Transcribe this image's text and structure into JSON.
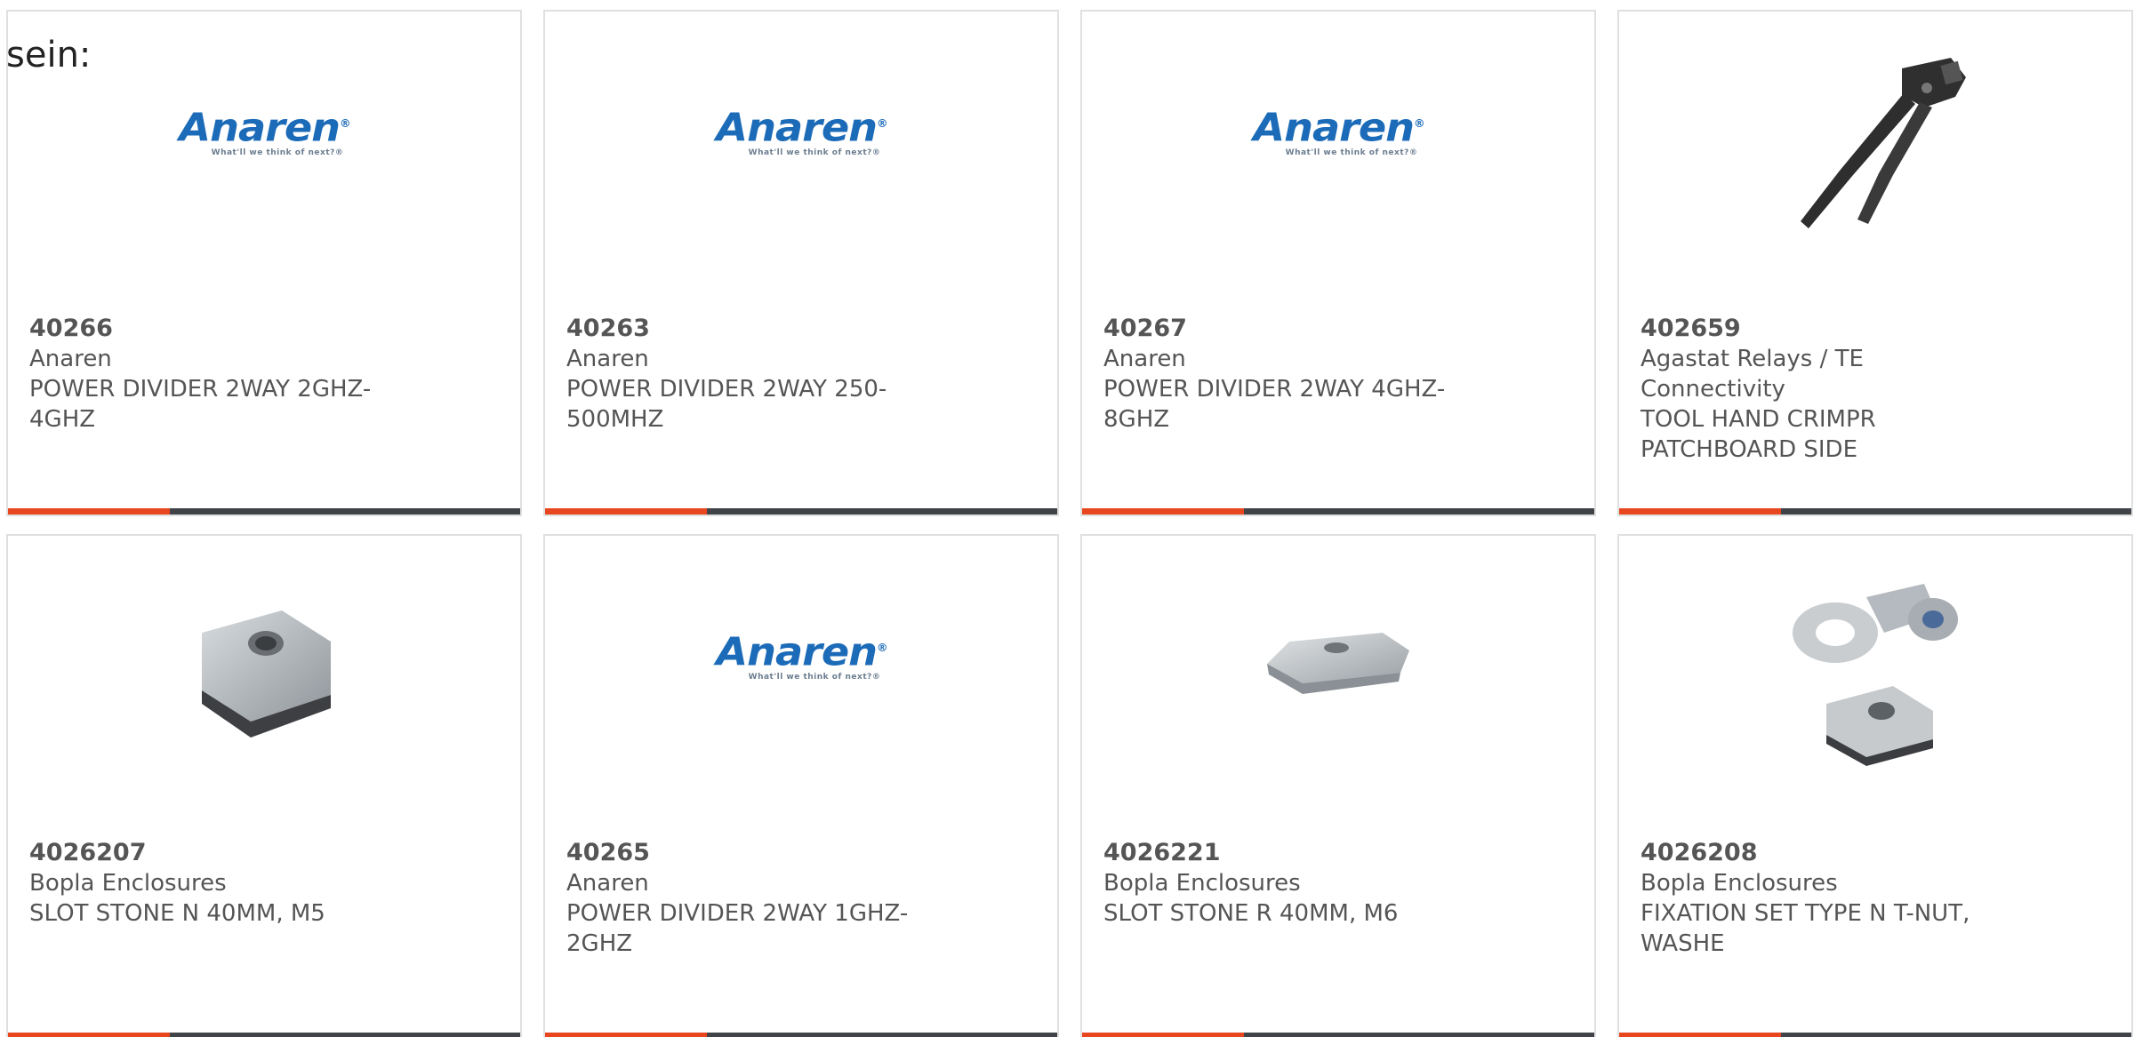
{
  "intro": {
    "text": "sein:"
  },
  "colors": {
    "accent": "#e8461e",
    "bar": "#404448",
    "brand_blue": "#1c6bb8"
  },
  "products": [
    {
      "part_number": "40266",
      "manufacturer": "Anaren",
      "description_line1": "POWER DIVIDER 2WAY 2GHZ-",
      "description_line2": "4GHZ",
      "image": "anaren-logo"
    },
    {
      "part_number": "40263",
      "manufacturer": "Anaren",
      "description_line1": "POWER DIVIDER 2WAY 250-",
      "description_line2": "500MHZ",
      "image": "anaren-logo"
    },
    {
      "part_number": "40267",
      "manufacturer": "Anaren",
      "description_line1": "POWER DIVIDER 2WAY 4GHZ-",
      "description_line2": "8GHZ",
      "image": "anaren-logo"
    },
    {
      "part_number": "402659",
      "manufacturer": "Agastat Relays / TE Connectivity",
      "description_line1": "TOOL HAND CRIMPR",
      "description_line2": "PATCHBOARD SIDE",
      "image": "crimp-tool-photo"
    },
    {
      "part_number": "4026207",
      "manufacturer": "Bopla Enclosures",
      "description_line1": "SLOT STONE N 40MM, M5",
      "description_line2": "",
      "image": "slot-stone-n-photo"
    },
    {
      "part_number": "40265",
      "manufacturer": "Anaren",
      "description_line1": "POWER DIVIDER 2WAY 1GHZ-",
      "description_line2": "2GHZ",
      "image": "anaren-logo"
    },
    {
      "part_number": "4026221",
      "manufacturer": "Bopla Enclosures",
      "description_line1": "SLOT STONE R 40MM, M6",
      "description_line2": "",
      "image": "slot-stone-r-photo"
    },
    {
      "part_number": "4026208",
      "manufacturer": "Bopla Enclosures",
      "description_line1": "FIXATION SET TYPE N T-NUT,",
      "description_line2": "WASHE",
      "image": "fixation-set-photo"
    }
  ],
  "logo": {
    "word": "Anaren",
    "reg": "®",
    "tagline": "What'll we think of next?®"
  }
}
